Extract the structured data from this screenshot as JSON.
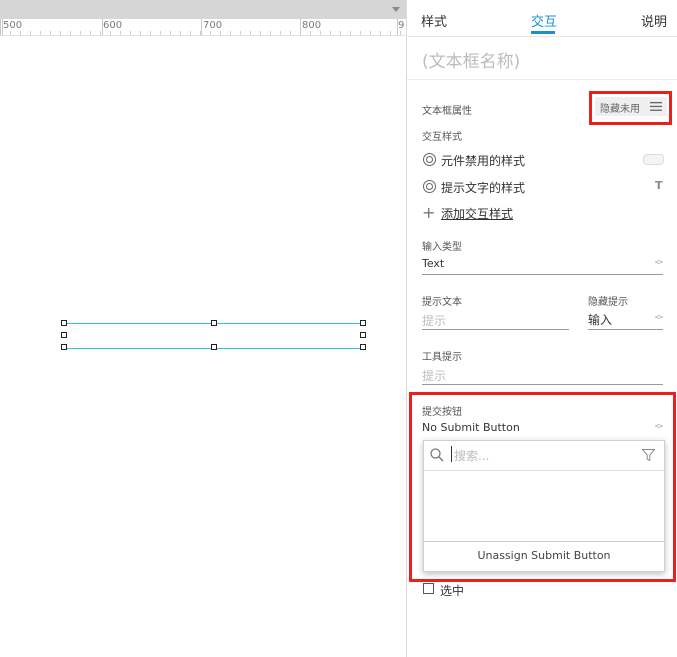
{
  "ruler": {
    "labels": [
      "500",
      "600",
      "700",
      "800",
      "9"
    ]
  },
  "panel": {
    "tabs": [
      "样式",
      "交互",
      "说明"
    ],
    "active_tab": "交互",
    "name_placeholder": "(文本框名称)",
    "textbox_props_label": "文本框属性",
    "hide_disabled": "隐藏未用",
    "interaction_styles_label": "交互样式",
    "disabled_style": "元件禁用的样式",
    "hint_style": "提示文字的样式",
    "hint_style_icon": "T",
    "add_style": "添加交互样式",
    "input_type_label": "输入类型",
    "input_type_value": "Text",
    "hint_text_label": "提示文本",
    "hint_text_placeholder": "提示",
    "hide_hint_label": "隐藏提示",
    "hide_hint_value": "输入",
    "tooltip_label": "工具提示",
    "tooltip_placeholder": "提示",
    "submit_label": "提交按钮",
    "submit_value": "No Submit Button",
    "search_placeholder": "搜索...",
    "unassign": "Unassign Submit Button",
    "checked_label": "选中"
  },
  "colors": {
    "accent": "#1b8fd6",
    "highlight": "#e8221b",
    "selection": "#2ec4e4"
  }
}
